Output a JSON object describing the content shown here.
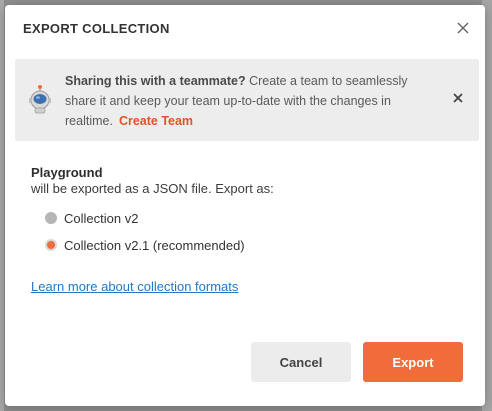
{
  "dialog": {
    "title": "EXPORT COLLECTION",
    "close_icon": "close-icon"
  },
  "banner": {
    "bold_text": "Sharing this with a teammate?",
    "text": " Create a team to seamlessly share it and keep your team up-to-date with the changes in realtime.",
    "link_text": "Create Team",
    "icon": "astronaut-icon",
    "close_icon": "close-icon"
  },
  "export": {
    "collection_name": "Playground",
    "description": "will be exported as a JSON file. Export as:",
    "options": [
      {
        "label": "Collection v2",
        "selected": false
      },
      {
        "label": "Collection v2.1 (recommended)",
        "selected": true
      }
    ],
    "learn_more": "Learn more about collection formats"
  },
  "actions": {
    "cancel_label": "Cancel",
    "export_label": "Export"
  },
  "colors": {
    "accent": "#f26b3a",
    "link": "#2478c5",
    "banner_link": "#e0532b"
  }
}
